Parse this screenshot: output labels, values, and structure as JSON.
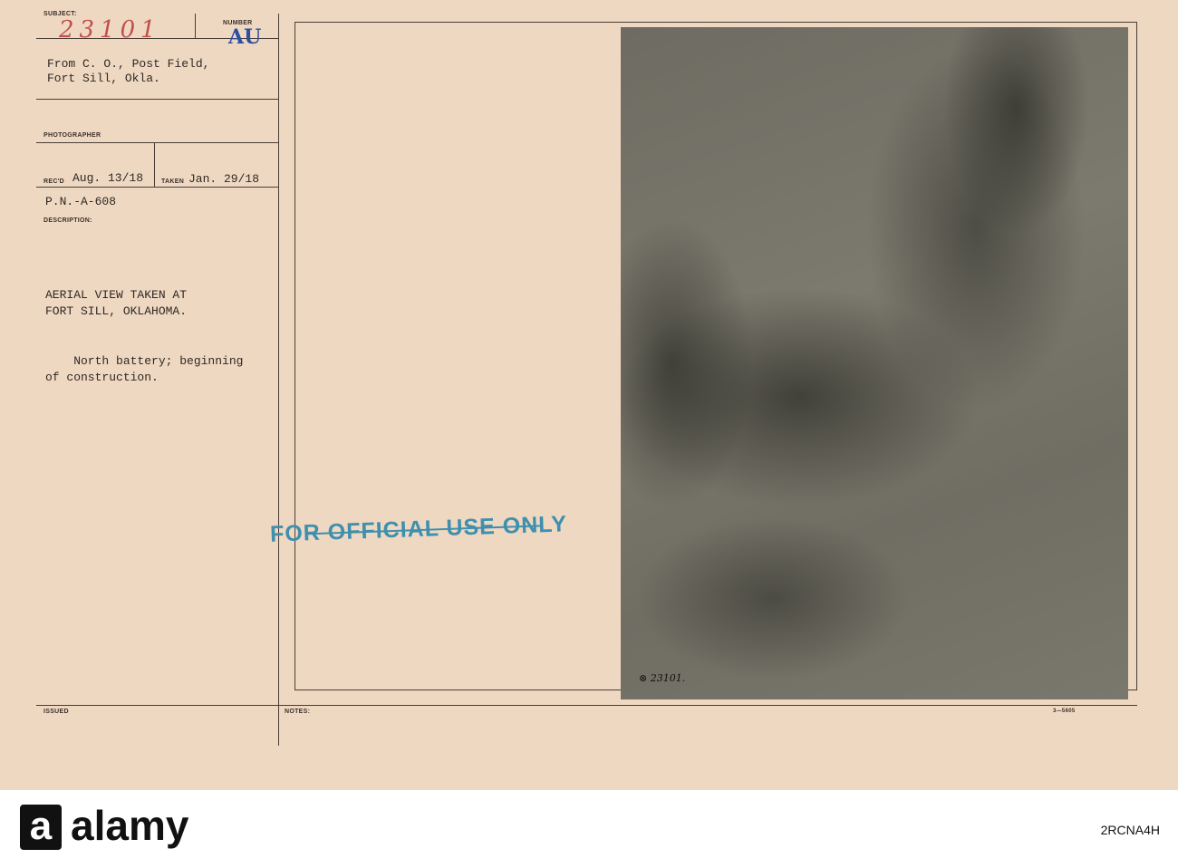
{
  "card": {
    "subject_label": "SUBJECT:",
    "subject_value": "23101",
    "number_label": "NUMBER",
    "number_value": "AU",
    "from_lines": [
      "From C. O., Post Field,",
      "Fort Sill, Okla."
    ],
    "photographer_label": "PHOTOGRAPHER",
    "recd_label": "REC'D",
    "recd_value": "Aug. 13/18",
    "taken_label": "TAKEN",
    "taken_value": "Jan. 29/18",
    "pn": "P.N.-A-608",
    "description_label": "DESCRIPTION:",
    "description_lines": [
      "AERIAL VIEW TAKEN AT",
      "FORT SILL, OKLAHOMA.",
      "",
      "    North battery; beginning",
      "of construction."
    ],
    "issued_label": "ISSUED",
    "notes_label": "NOTES:",
    "form_number": "3—5605",
    "stamp": "FOR OFFICIAL USE ONLY",
    "photo_caption": "⊗ 23101."
  },
  "footer": {
    "brand": "alamy",
    "image_id": "2RCNA4H",
    "logo_letter": "a"
  }
}
